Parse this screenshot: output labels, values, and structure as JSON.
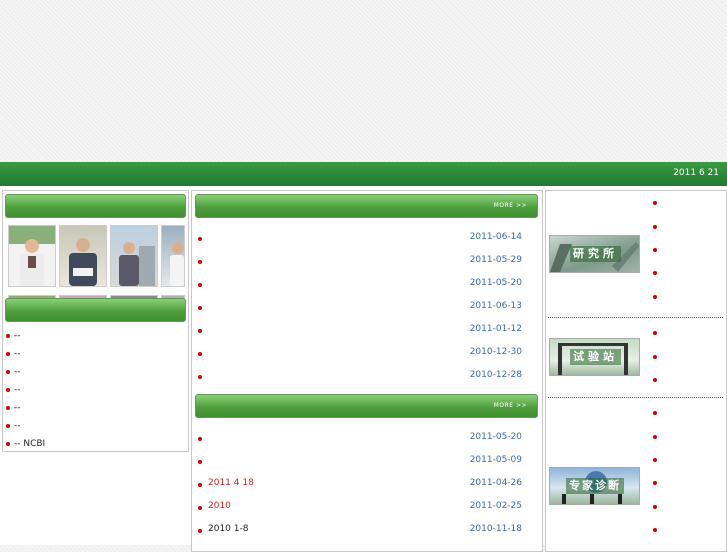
{
  "header": {
    "date": "2011 6 21"
  },
  "left": {
    "links": [
      "--",
      "--",
      "--",
      "--",
      "--",
      "--",
      "-- NCBI"
    ]
  },
  "middle": {
    "more_label": "MORE >>",
    "news1": [
      {
        "title": "",
        "date": "2011-06-14"
      },
      {
        "title": "",
        "date": "2011-05-29"
      },
      {
        "title": "",
        "date": "2011-05-20"
      },
      {
        "title": "",
        "date": "2011-06-13"
      },
      {
        "title": "",
        "date": "2011-01-12"
      },
      {
        "title": "",
        "date": "2010-12-30"
      },
      {
        "title": "",
        "date": "2010-12-28"
      }
    ],
    "news2": [
      {
        "title": "",
        "date": "2011-05-20"
      },
      {
        "title": "",
        "date": "2011-05-09"
      },
      {
        "title": "2011 4 18",
        "date": "2011-04-26",
        "color": "red"
      },
      {
        "title": "2010",
        "date": "2011-02-25",
        "color": "red"
      },
      {
        "title": "2010 1-8",
        "date": "2010-11-18"
      }
    ]
  },
  "right": {
    "thumbs": [
      {
        "label": "研究所"
      },
      {
        "label": "试验站"
      },
      {
        "label": "专家诊断"
      }
    ]
  },
  "colors": {
    "green": "#2e8b3a",
    "accent_red": "#cc2222",
    "date_blue": "#3a6aa0"
  }
}
